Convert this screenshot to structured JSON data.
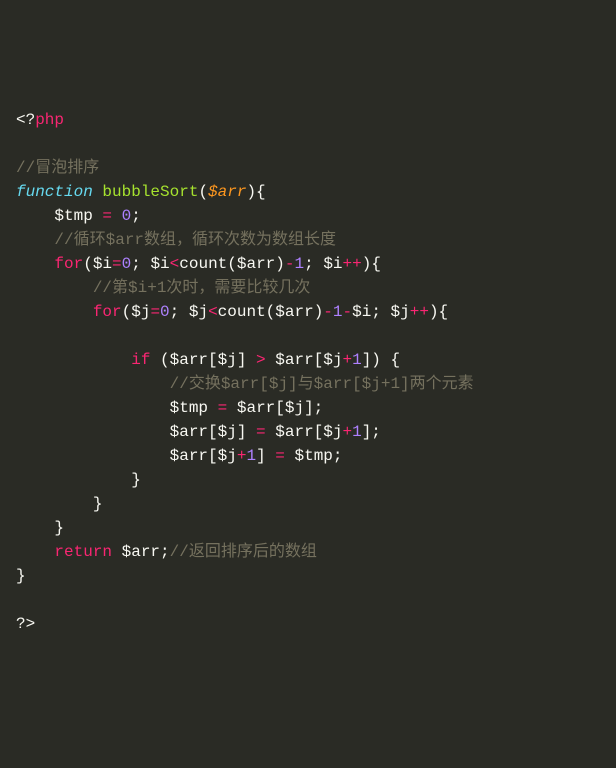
{
  "l1a": "<?",
  "l1b": "php",
  "l3": "//冒泡排序",
  "l4a": "function",
  "l4b": " ",
  "l4c": "bubbleSort",
  "l4d": "(",
  "l4e": "$arr",
  "l4f": "){",
  "l5a": "    ",
  "l5b": "$tmp",
  "l5c": " ",
  "l5d": "=",
  "l5e": " ",
  "l5f": "0",
  "l5g": ";",
  "l6a": "    ",
  "l6b": "//循环$arr数组，循环次数为数组长度",
  "l7a": "    ",
  "l7b": "for",
  "l7c": "(",
  "l7d": "$i",
  "l7e": "=",
  "l7f": "0",
  "l7g": "; ",
  "l7h": "$i",
  "l7i": "<",
  "l7j": "count(",
  "l7k": "$arr",
  "l7l": ")",
  "l7m": "-",
  "l7n": "1",
  "l7o": "; ",
  "l7p": "$i",
  "l7q": "++",
  "l7r": "){",
  "l8a": "        ",
  "l8b": "//第$i+1次时，需要比较几次",
  "l9a": "        ",
  "l9b": "for",
  "l9c": "(",
  "l9d": "$j",
  "l9e": "=",
  "l9f": "0",
  "l9g": "; ",
  "l9h": "$j",
  "l9i": "<",
  "l9j": "count(",
  "l9k": "$arr",
  "l9l": ")",
  "l9m": "-",
  "l9n": "1",
  "l9o": "-",
  "l9p": "$i",
  "l9q": "; ",
  "l9r": "$j",
  "l9s": "++",
  "l9t": "){",
  "l11a": "            ",
  "l11b": "if",
  "l11c": " (",
  "l11d": "$arr",
  "l11e": "[",
  "l11f": "$j",
  "l11g": "] ",
  "l11h": ">",
  "l11i": " ",
  "l11j": "$arr",
  "l11k": "[",
  "l11l": "$j",
  "l11m": "+",
  "l11n": "1",
  "l11o": "]) {",
  "l12a": "                ",
  "l12b": "//交换$arr[$j]与$arr[$j+1]两个元素",
  "l13a": "                ",
  "l13b": "$tmp",
  "l13c": " ",
  "l13d": "=",
  "l13e": " ",
  "l13f": "$arr",
  "l13g": "[",
  "l13h": "$j",
  "l13i": "];",
  "l14a": "                ",
  "l14b": "$arr",
  "l14c": "[",
  "l14d": "$j",
  "l14e": "] ",
  "l14f": "=",
  "l14g": " ",
  "l14h": "$arr",
  "l14i": "[",
  "l14j": "$j",
  "l14k": "+",
  "l14l": "1",
  "l14m": "];",
  "l15a": "                ",
  "l15b": "$arr",
  "l15c": "[",
  "l15d": "$j",
  "l15e": "+",
  "l15f": "1",
  "l15g": "] ",
  "l15h": "=",
  "l15i": " ",
  "l15j": "$tmp",
  "l15k": ";",
  "l16a": "            }",
  "l17a": "        }",
  "l18a": "    }",
  "l19a": "    ",
  "l19b": "return",
  "l19c": " ",
  "l19d": "$arr",
  "l19e": ";",
  "l19f": "//返回排序后的数组",
  "l20a": "}",
  "l22a": "?>"
}
